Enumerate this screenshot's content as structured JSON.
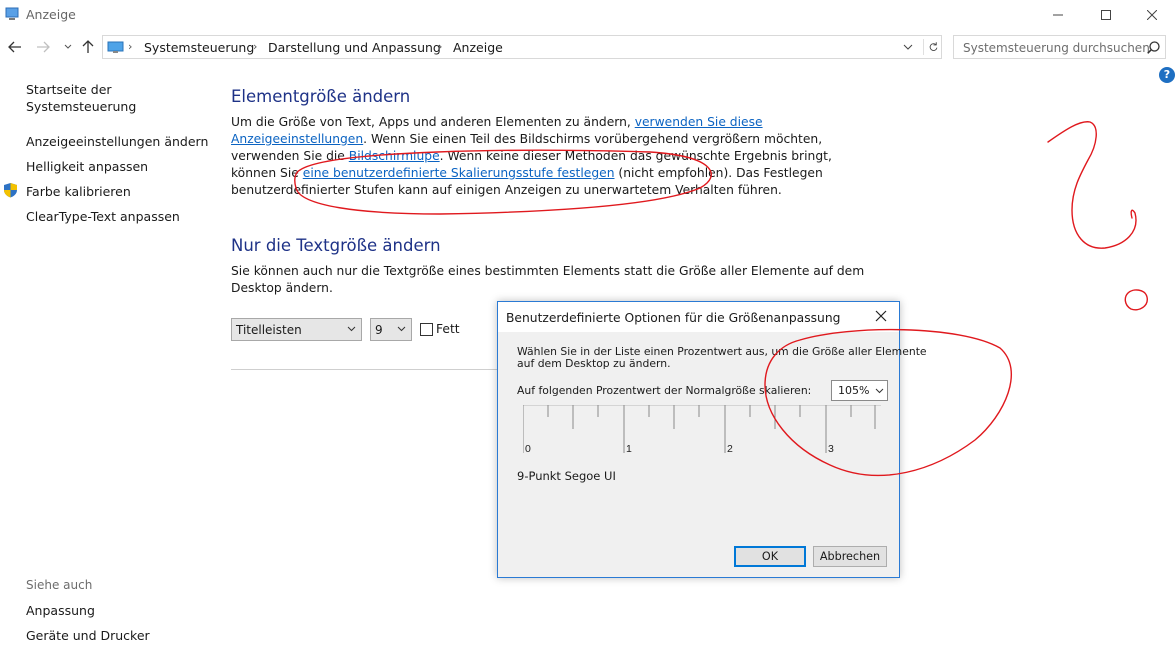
{
  "window": {
    "title": "Anzeige"
  },
  "breadcrumb": {
    "items": [
      "Systemsteuerung",
      "Darstellung und Anpassung",
      "Anzeige"
    ]
  },
  "search": {
    "placeholder": "Systemsteuerung durchsuchen"
  },
  "help_label": "?",
  "sidebar": {
    "links": [
      "Startseite der",
      "Systemsteuerung",
      "Anzeigeeinstellungen ändern",
      "Helligkeit anpassen",
      "Farbe kalibrieren",
      "ClearType-Text anpassen"
    ],
    "see_also_heading": "Siehe auch",
    "see_also": [
      "Anpassung",
      "Geräte und Drucker"
    ]
  },
  "section1": {
    "heading": "Elementgröße ändern",
    "l1a": "Um die Größe von Text, Apps und anderen Elementen zu ändern, ",
    "l1link": "verwenden Sie diese",
    "l2link": "Anzeigeeinstellungen",
    "l2b": ". Wenn Sie einen Teil des Bildschirms vorübergehend vergrößern möchten,",
    "l3a": "verwenden Sie die ",
    "l3link": "Bildschirmlupe",
    "l3b": ". Wenn keine dieser Methoden das gewünschte Ergebnis bringt,",
    "l4a": "können Sie ",
    "l4link": "eine benutzerdefinierte Skalierungsstufe festlegen",
    "l4b": " (nicht empfohlen). Das Festlegen",
    "l5": "benutzerdefinierter Stufen kann auf einigen Anzeigen zu unerwartetem Verhalten führen."
  },
  "section2": {
    "heading": "Nur die Textgröße ändern",
    "l1": "Sie können auch nur die Textgröße eines bestimmten Elements statt die Größe aller Elemente auf dem",
    "l2": "Desktop ändern.",
    "element_select": "Titelleisten",
    "size_select": "9",
    "bold_label": "Fett"
  },
  "dialog": {
    "title": "Benutzerdefinierte Optionen für die Größenanpassung",
    "desc1": "Wählen Sie in der Liste einen Prozentwert aus, um die Größe aller Elemente",
    "desc2": "auf dem Desktop zu ändern.",
    "scale_label": "Auf folgenden Prozentwert der Normalgröße skalieren:",
    "scale_value": "105%",
    "ruler_labels": [
      "0",
      "1",
      "2",
      "3"
    ],
    "font_info": "9-Punkt Segoe UI",
    "ok": "OK",
    "cancel": "Abbrechen"
  },
  "colors": {
    "heading": "#1e3287",
    "link": "#0b63c2",
    "annotation": "#e0191e",
    "accent": "#0078d7"
  }
}
